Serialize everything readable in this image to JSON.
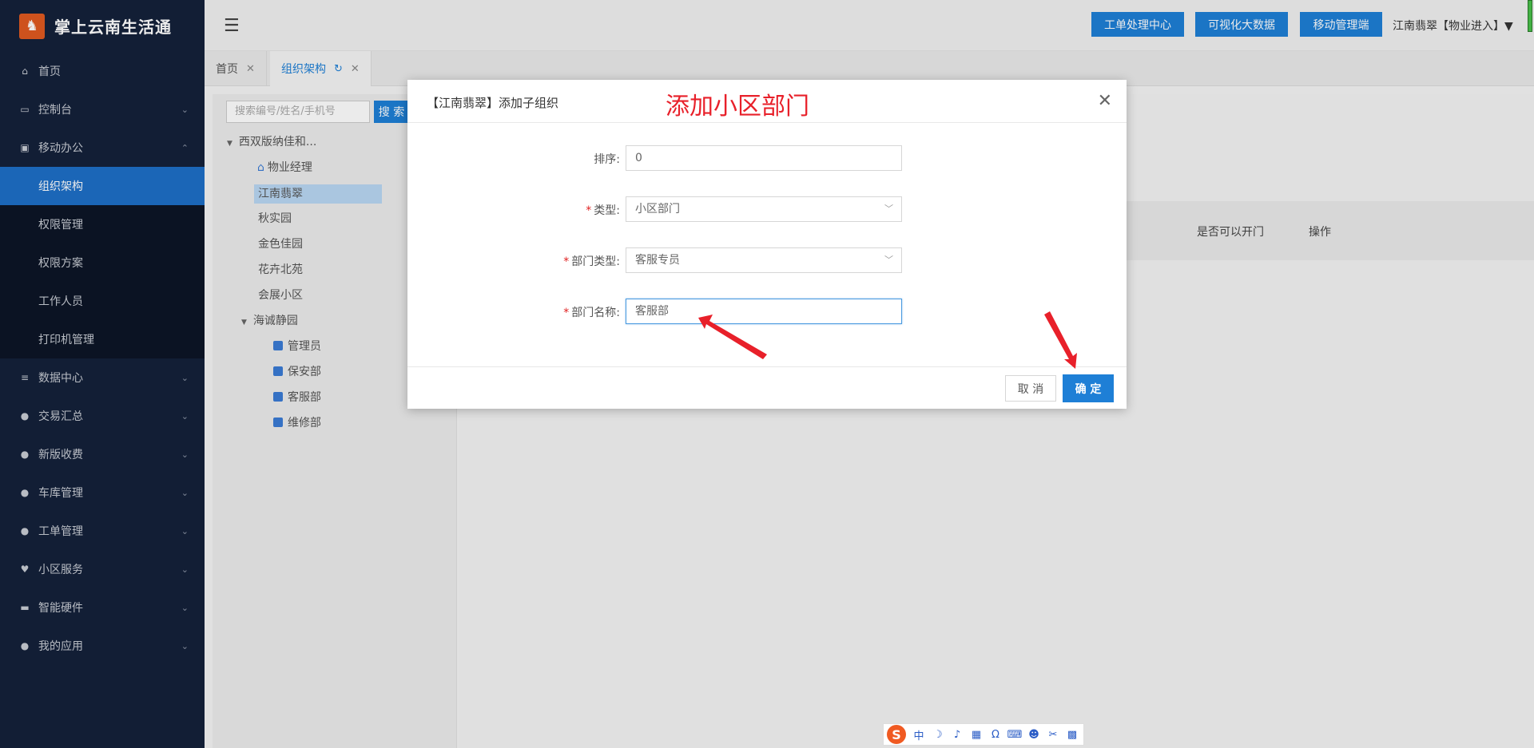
{
  "app": {
    "title": "掌上云南生活通",
    "logo_glyph": "♞"
  },
  "sidebar": {
    "items": [
      {
        "label": "首页",
        "icon": "home-icon",
        "glyph": "⌂"
      },
      {
        "label": "控制台",
        "icon": "monitor-icon",
        "glyph": "▭"
      },
      {
        "label": "移动办公",
        "icon": "briefcase-icon",
        "glyph": "▣"
      },
      {
        "label": "组织架构"
      },
      {
        "label": "权限管理"
      },
      {
        "label": "权限方案"
      },
      {
        "label": "工作人员"
      },
      {
        "label": "打印机管理"
      },
      {
        "label": "数据中心",
        "icon": "database-icon",
        "glyph": "≡"
      },
      {
        "label": "交易汇总",
        "icon": "moneybag-icon",
        "glyph": "●"
      },
      {
        "label": "新版收费",
        "icon": "chat-icon",
        "glyph": "●"
      },
      {
        "label": "车库管理",
        "icon": "chat-icon",
        "glyph": "●"
      },
      {
        "label": "工单管理",
        "icon": "chat-icon",
        "glyph": "●"
      },
      {
        "label": "小区服务",
        "icon": "heart-icon",
        "glyph": "♥"
      },
      {
        "label": "智能硬件",
        "icon": "drive-icon",
        "glyph": "▬"
      },
      {
        "label": "我的应用",
        "icon": "user-icon",
        "glyph": "●"
      }
    ]
  },
  "topbar": {
    "btn1": "工单处理中心",
    "btn2": "可视化大数据",
    "btn3": "移动管理端",
    "user": "江南翡翠【物业进入】▼"
  },
  "tabs": [
    {
      "label": "首页"
    },
    {
      "label": "组织架构"
    }
  ],
  "org": {
    "search_placeholder": "搜索编号/姓名/手机号",
    "search_button": "搜 索",
    "tree": [
      "西双版纳佳和...",
      "物业经理",
      "江南翡翠",
      "秋实园",
      "金色佳园",
      "花卉北苑",
      "会展小区",
      "海诚静园",
      "管理员",
      "保安部",
      "客服部",
      "维修部"
    ]
  },
  "main_table": {
    "col_door": "是否可以开门",
    "col_action": "操作"
  },
  "modal": {
    "title": "【江南翡翠】添加子组织",
    "annotation": "添加小区部门",
    "fields": {
      "order_label": "排序:",
      "order_value": "0",
      "type_label": "类型:",
      "type_value": "小区部门",
      "dept_type_label": "部门类型:",
      "dept_type_value": "客服专员",
      "dept_name_label": "部门名称:",
      "dept_name_value": "客服部"
    },
    "cancel": "取 消",
    "ok": "确 定"
  },
  "ime": {
    "logo": "S",
    "items": [
      "中",
      "☽",
      "♪",
      "▦",
      "Ω",
      "⌨",
      "☻",
      "✂",
      "▩"
    ]
  },
  "colors": {
    "accent": "#1e7fd6",
    "sidebar": "#14213a",
    "annotation": "#e8202a"
  }
}
